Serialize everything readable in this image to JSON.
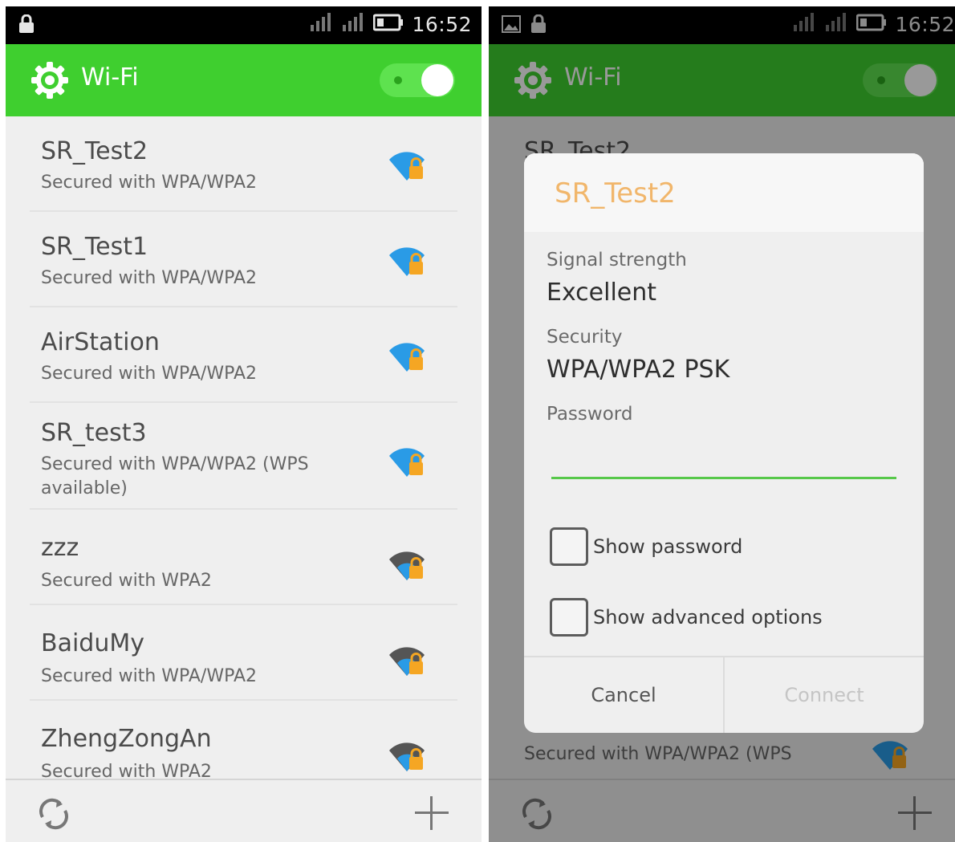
{
  "status_bar": {
    "time": "16:52"
  },
  "app_bar": {
    "title": "Wi-Fi",
    "accent_color": "#3fcf2f",
    "wifi_enabled": true
  },
  "networks": [
    {
      "name": "SR_Test2",
      "security": "Secured with WPA/WPA2",
      "signal_color": "#2a9be6"
    },
    {
      "name": "SR_Test1",
      "security": "Secured with WPA/WPA2",
      "signal_color": "#2a9be6"
    },
    {
      "name": "AirStation",
      "security": "Secured with WPA/WPA2",
      "signal_color": "#2a9be6"
    },
    {
      "name": "SR_test3",
      "security": "Secured with WPA/WPA2 (WPS available)",
      "signal_color": "#2a9be6"
    },
    {
      "name": "zzz",
      "security": "Secured with WPA2",
      "signal_color": "#555555"
    },
    {
      "name": "BaiduMy",
      "security": "Secured with WPA/WPA2",
      "signal_color": "#555555"
    },
    {
      "name": "ZhengZongAn",
      "security": "Secured with WPA2",
      "signal_color": "#555555"
    }
  ],
  "background_list": {
    "top_name": "SR_Test2",
    "bottom_security": "Secured with WPA/WPA2 (WPS"
  },
  "dialog": {
    "title": "SR_Test2",
    "signal_label": "Signal strength",
    "signal_value": "Excellent",
    "security_label": "Security",
    "security_value": "WPA/WPA2 PSK",
    "password_label": "Password",
    "password_value": "",
    "show_password_label": "Show password",
    "show_advanced_label": "Show advanced options",
    "cancel_label": "Cancel",
    "connect_label": "Connect"
  }
}
